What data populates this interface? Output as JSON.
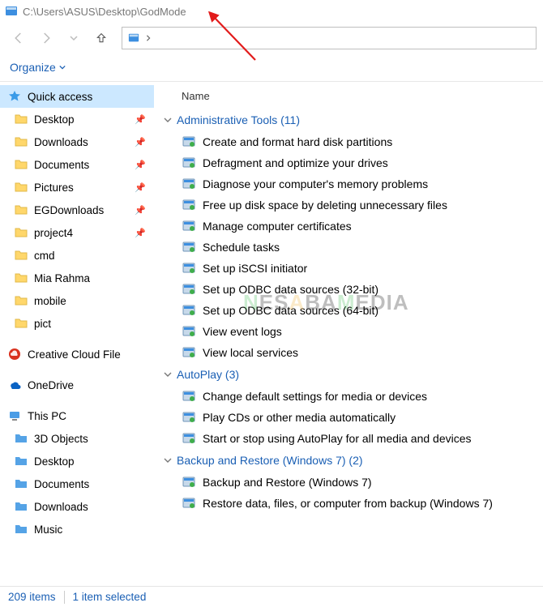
{
  "title_path": "C:\\Users\\ASUS\\Desktop\\GodMode",
  "toolbar": {
    "organize": "Organize"
  },
  "columns": {
    "name": "Name"
  },
  "sidebar": {
    "quick_access": "Quick access",
    "items": [
      {
        "label": "Desktop",
        "pinned": true
      },
      {
        "label": "Downloads",
        "pinned": true
      },
      {
        "label": "Documents",
        "pinned": true
      },
      {
        "label": "Pictures",
        "pinned": true
      },
      {
        "label": "EGDownloads",
        "pinned": true
      },
      {
        "label": "project4",
        "pinned": true
      },
      {
        "label": "cmd",
        "pinned": false
      },
      {
        "label": "Mia Rahma",
        "pinned": false
      },
      {
        "label": "mobile",
        "pinned": false
      },
      {
        "label": "pict",
        "pinned": false
      }
    ],
    "cc": "Creative Cloud File",
    "onedrive": "OneDrive",
    "thispc": "This PC",
    "pc_items": [
      {
        "label": "3D Objects"
      },
      {
        "label": "Desktop"
      },
      {
        "label": "Documents"
      },
      {
        "label": "Downloads"
      },
      {
        "label": "Music"
      }
    ]
  },
  "groups": [
    {
      "title": "Administrative Tools",
      "count": 11,
      "items": [
        "Create and format hard disk partitions",
        "Defragment and optimize your drives",
        "Diagnose your computer's memory problems",
        "Free up disk space by deleting unnecessary files",
        "Manage computer certificates",
        "Schedule tasks",
        "Set up iSCSI initiator",
        "Set up ODBC data sources (32-bit)",
        "Set up ODBC data sources (64-bit)",
        "View event logs",
        "View local services"
      ]
    },
    {
      "title": "AutoPlay",
      "count": 3,
      "items": [
        "Change default settings for media or devices",
        "Play CDs or other media automatically",
        "Start or stop using AutoPlay for all media and devices"
      ]
    },
    {
      "title": "Backup and Restore (Windows 7)",
      "count": 2,
      "items": [
        "Backup and Restore (Windows 7)",
        "Restore data, files, or computer from backup (Windows 7)"
      ]
    }
  ],
  "status": {
    "count": "209 items",
    "selected": "1 item selected"
  }
}
